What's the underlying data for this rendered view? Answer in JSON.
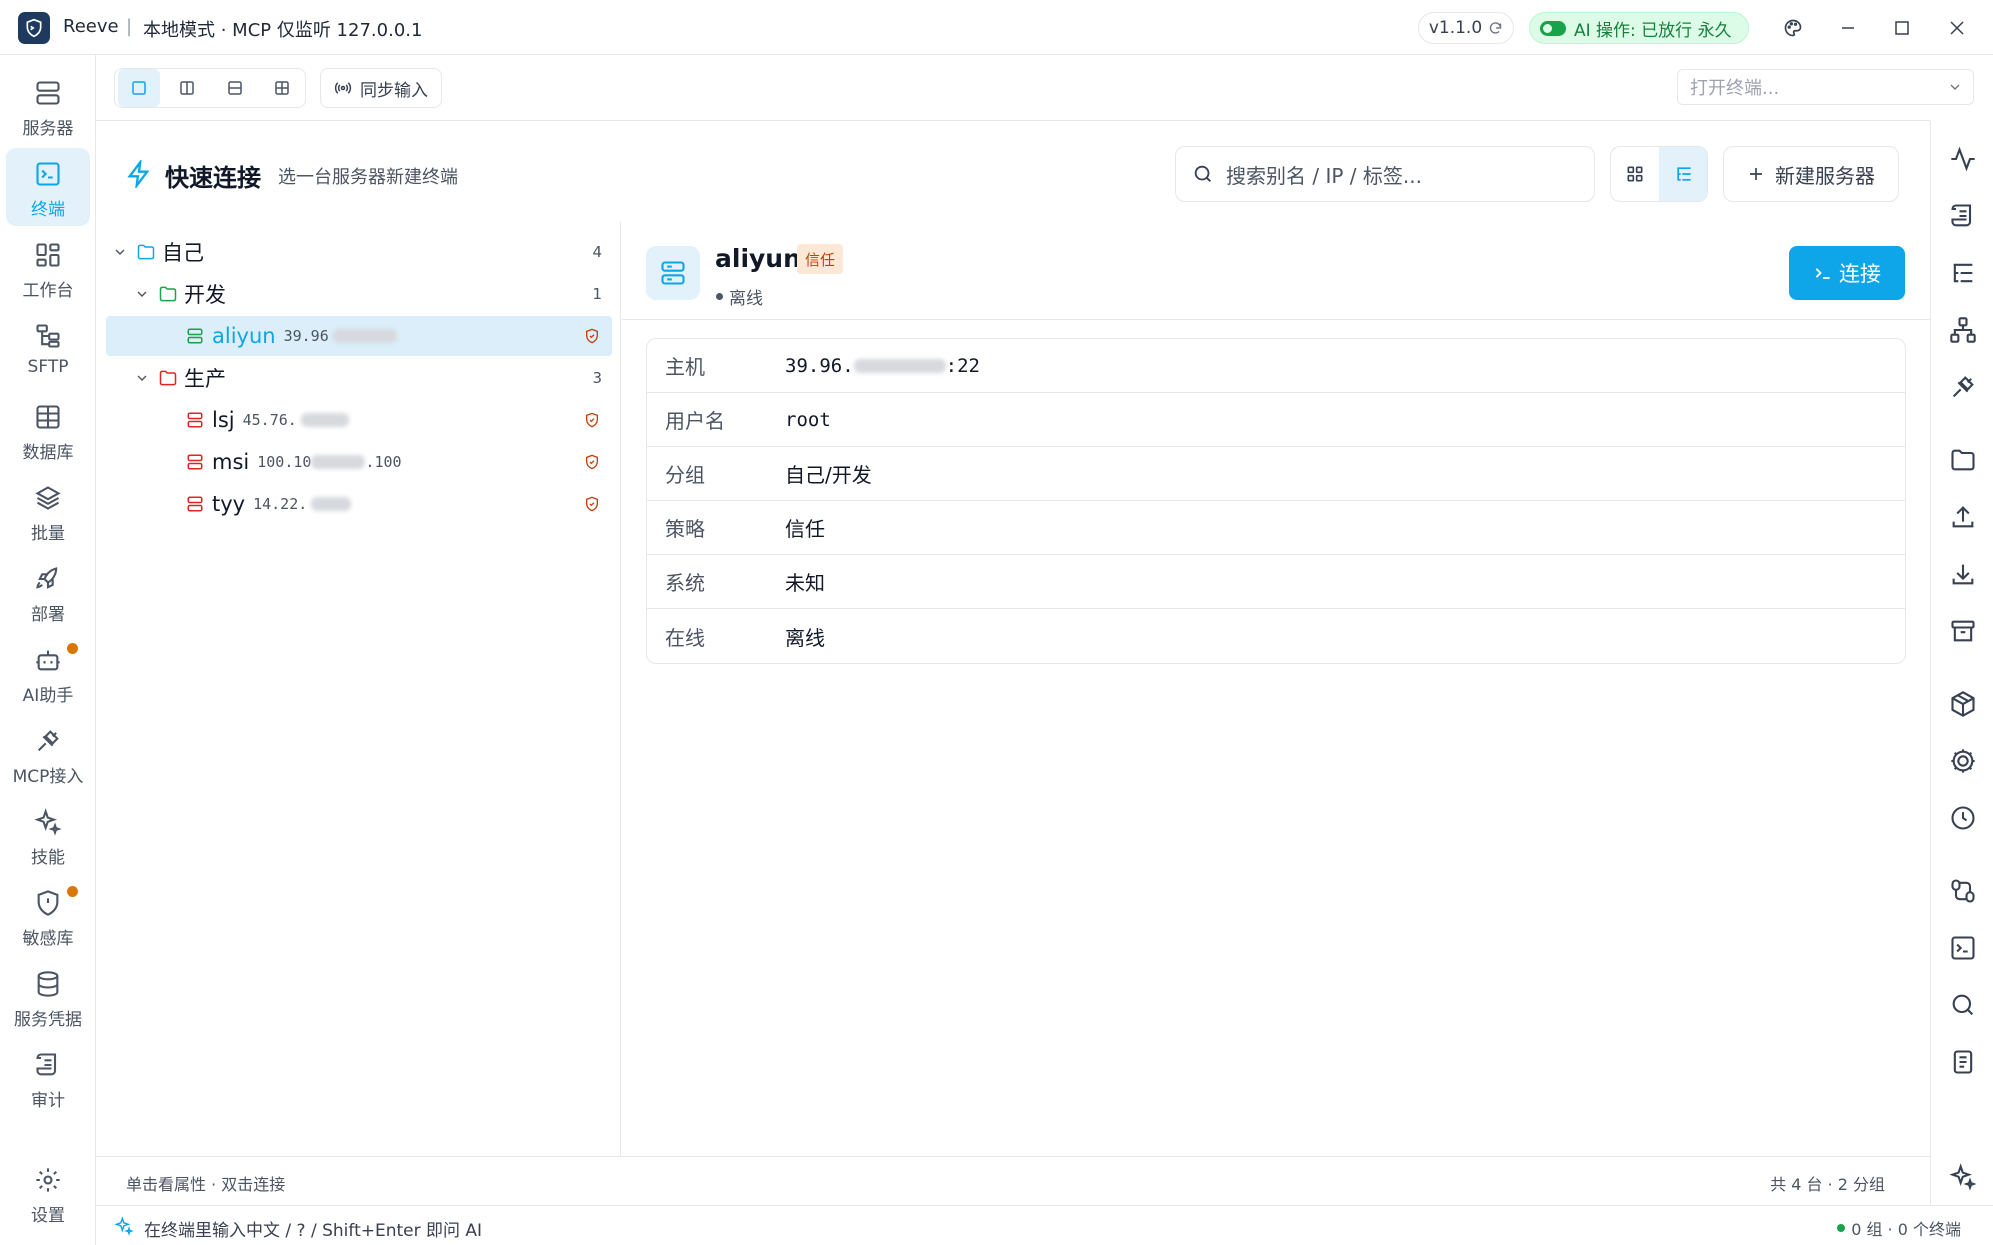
{
  "titlebar": {
    "app_name": "Reeve",
    "separator": "|",
    "mode": "本地模式 · MCP 仅监听 127.0.0.1",
    "version": "v1.1.0",
    "ai_status": "AI 操作: 已放行 永久"
  },
  "sidebar": {
    "items": [
      {
        "label": "服务器",
        "icon": "server-icon"
      },
      {
        "label": "终端",
        "icon": "terminal-icon",
        "active": true
      },
      {
        "label": "工作台",
        "icon": "dashboard-icon"
      },
      {
        "label": "SFTP",
        "icon": "sftp-icon"
      },
      {
        "label": "数据库",
        "icon": "database-table-icon"
      },
      {
        "label": "批量",
        "icon": "layers-icon"
      },
      {
        "label": "部署",
        "icon": "rocket-icon"
      },
      {
        "label": "AI助手",
        "icon": "bot-icon"
      },
      {
        "label": "MCP接入",
        "icon": "plug-icon"
      },
      {
        "label": "技能",
        "icon": "sparkles-icon"
      },
      {
        "label": "敏感库",
        "icon": "shield-alert-icon"
      },
      {
        "label": "服务凭据",
        "icon": "database-icon"
      },
      {
        "label": "审计",
        "icon": "scroll-icon"
      },
      {
        "label": "设置",
        "icon": "gear-icon"
      }
    ]
  },
  "toolbar": {
    "sync_input_label": "同步输入",
    "open_terminal_placeholder": "打开终端..."
  },
  "header": {
    "title": "快速连接",
    "subtitle": "选一台服务器新建终端",
    "search_placeholder": "搜索别名 / IP / 标签...",
    "new_server_label": "新建服务器"
  },
  "tree": {
    "root": {
      "name": "自己",
      "count": "4"
    },
    "dev": {
      "name": "开发",
      "count": "1"
    },
    "prod": {
      "name": "生产",
      "count": "3"
    },
    "servers": [
      {
        "alias": "aliyun",
        "ip": "39.96"
      },
      {
        "alias": "lsj",
        "ip": "45.76."
      },
      {
        "alias": "msi",
        "ip_a": "100.10",
        "ip_b": ".100"
      },
      {
        "alias": "tyy",
        "ip": "14.22."
      }
    ]
  },
  "detail": {
    "name": "aliyun",
    "badge": "信任",
    "status": "离线",
    "connect_label": "连接",
    "rows": [
      {
        "key": "主机",
        "value_a": "39.96.",
        "value_b": ":22"
      },
      {
        "key": "用户名",
        "value": "root"
      },
      {
        "key": "分组",
        "value": "自己/开发"
      },
      {
        "key": "策略",
        "value": "信任"
      },
      {
        "key": "系统",
        "value": "未知"
      },
      {
        "key": "在线",
        "value": "离线"
      }
    ]
  },
  "footer": {
    "hint": "单击看属性 · 双击连接",
    "summary": "共 4 台 · 2 分组"
  },
  "statusbar": {
    "ai_hint": "在终端里输入中文 / ? / Shift+Enter 即问 AI",
    "terminal_count": "0 组 · 0 个终端"
  },
  "colors": {
    "accent": "#0ea5e9",
    "active_bg": "#e3f1fb",
    "trust_badge_bg": "#fde8d7",
    "trust_badge_text": "#c2410c",
    "server_prod": "#dc2626",
    "server_dev": "#16a34a",
    "ai_pill_bg": "#dcfce7",
    "ai_pill_text": "#15803d"
  }
}
